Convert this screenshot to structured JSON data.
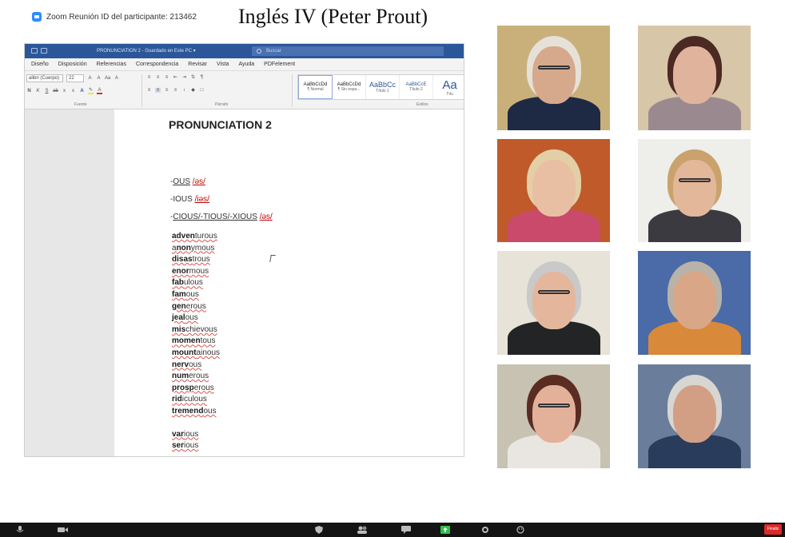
{
  "zoom": {
    "meeting_id_label": "Zoom Reunión ID del participante: 213462",
    "class_title": "Inglés IV (Peter Prout)",
    "end_button": "Finaliz"
  },
  "word": {
    "titlebar": {
      "doc_name": "PRONUNCIATION 2 - Guardado en Este PC ▾",
      "search_placeholder": "Buscar"
    },
    "menu": [
      "Diseño",
      "Disposición",
      "Referencias",
      "Correspondencia",
      "Revisar",
      "Vista",
      "Ayuda",
      "PDFelement"
    ],
    "ribbon": {
      "font_name": "alibri (Cuerpo)",
      "font_size": "22",
      "groups": [
        "Fuente",
        "Párrafo",
        "Estilos"
      ],
      "styles": [
        {
          "sample": "AaBbCcDd",
          "name": "¶ Normal"
        },
        {
          "sample": "AaBbCcDd",
          "name": "¶ Sin espa..."
        },
        {
          "sample": "AaBbCc",
          "name": "Título 1"
        },
        {
          "sample": "AaBbCcE",
          "name": "Título 2"
        },
        {
          "sample": "Aa",
          "name": "Títu"
        }
      ]
    },
    "document": {
      "title": "PRONUNCIATION 2",
      "rules": [
        {
          "prefix": "-",
          "suffix": "OUS",
          "phonetic": "/əs/"
        },
        {
          "prefix": "-",
          "suffix": "IOUS",
          "phonetic": "/iəs/"
        },
        {
          "prefix": "-",
          "suffix": "CIOUS/-TIOUS/-XIOUS",
          "phonetic": "/əs/"
        }
      ],
      "words": [
        {
          "stress": "adven",
          "rest": "turous"
        },
        {
          "stress": "a",
          "rest": "nonymous",
          "mid": "non"
        },
        {
          "stress": "disas",
          "rest": "trous"
        },
        {
          "stress": "enor",
          "rest": "mous"
        },
        {
          "stress": "fab",
          "rest": "ulous"
        },
        {
          "stress": "fam",
          "rest": "ous"
        },
        {
          "stress": "gen",
          "rest": "erous"
        },
        {
          "stress": "jeal",
          "rest": "ous"
        },
        {
          "stress": "mis",
          "rest": "chievous"
        },
        {
          "stress": "momen",
          "rest": "tous"
        },
        {
          "stress": "mount",
          "rest": "ainous"
        },
        {
          "stress": "nerv",
          "rest": "ous"
        },
        {
          "stress": "num",
          "rest": "erous"
        },
        {
          "stress": "prosp",
          "rest": "erous"
        },
        {
          "stress": "rid",
          "rest": "iculous"
        },
        {
          "stress": "tremend",
          "rest": "ous"
        },
        {
          "stress": "var",
          "rest": "ious"
        },
        {
          "stress": "ser",
          "rest": "ious"
        }
      ]
    }
  },
  "participants": [
    {
      "id": "p1",
      "bg": "#c9b07a",
      "skin": "#d7a98c",
      "hair": "#e6e1d8",
      "shirt": "#1e2a44"
    },
    {
      "id": "p2",
      "bg": "#d8c6a8",
      "skin": "#e0b49c",
      "hair": "#4a2a22",
      "shirt": "#9a8a90"
    },
    {
      "id": "p3",
      "bg": "#c05a2a",
      "skin": "#e9bfa4",
      "hair": "#e3cfa6",
      "shirt": "#c94a6a"
    },
    {
      "id": "p4",
      "bg": "#eeeeea",
      "skin": "#e2b79a",
      "hair": "#c9a26c",
      "shirt": "#3a3a40"
    },
    {
      "id": "p5",
      "bg": "#e8e3d8",
      "skin": "#e4b79d",
      "hair": "#c9c9c9",
      "shirt": "#222426"
    },
    {
      "id": "p6",
      "bg": "#4a6aa8",
      "skin": "#d9a687",
      "hair": "#b9b2a8",
      "shirt": "#d9893a"
    },
    {
      "id": "p7",
      "bg": "#c8c2b2",
      "skin": "#e3b19a",
      "hair": "#5a2c22",
      "shirt": "#e9e6e2"
    },
    {
      "id": "p8",
      "bg": "#6a7e9c",
      "skin": "#d29f84",
      "hair": "#d8d6d2",
      "shirt": "#2a3c5c"
    }
  ]
}
